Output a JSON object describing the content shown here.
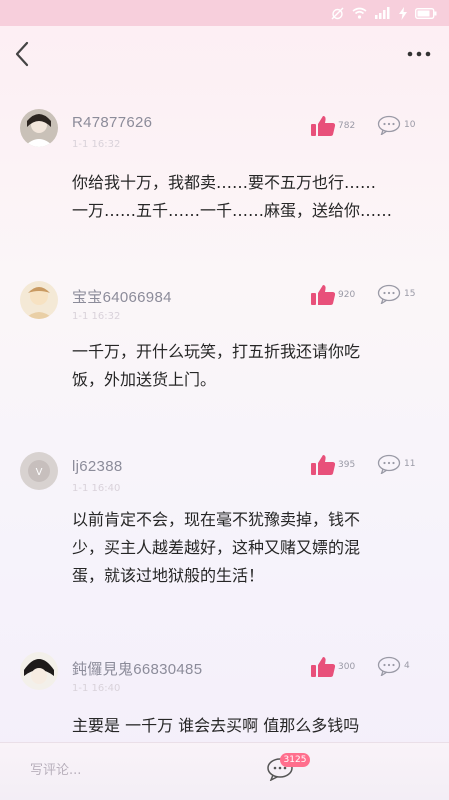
{
  "status_bar": {
    "icons": [
      "alarm-icon",
      "wifi-icon",
      "signal-icon",
      "charging-icon",
      "battery-icon"
    ],
    "battery": "▭"
  },
  "nav": {
    "back_icon": "chevron-left-icon",
    "more_icon": "more-icon",
    "more_label": "···"
  },
  "colors": {
    "accent": "#ff6f8d",
    "status_bar": "#f7cfdc",
    "username": "#8c8c9a"
  },
  "comments": [
    {
      "username": "R47877626",
      "timestamp": "1-1 16:32",
      "likes": "782",
      "replies": "10",
      "text_lines": [
        "你给我十万，我都卖……要不五万也行……",
        "一万……五千……一千……麻蛋，送给你……"
      ]
    },
    {
      "username": "宝宝64066984",
      "timestamp": "1-1 16:32",
      "likes": "920",
      "replies": "15",
      "text_lines": [
        "一千万，开什么玩笑，打五折我还请你吃",
        "饭，外加送货上门。"
      ]
    },
    {
      "username": "lj62388",
      "timestamp": "1-1 16:40",
      "likes": "395",
      "replies": "11",
      "text_lines": [
        "以前肯定不会，现在毫不犹豫卖掉，钱不",
        "少，买主人越差越好，这种又赌又嫖的混",
        "蛋，就该过地狱般的生活！"
      ]
    },
    {
      "username": "鈍儸見鬼66830485",
      "timestamp": "1-1 16:40",
      "likes": "300",
      "replies": "4",
      "text_lines": [
        "主要是 一千万 谁会去买啊 值那么多钱吗"
      ]
    }
  ],
  "bottom_bar": {
    "placeholder": "写评论...",
    "comment_count": "3125"
  }
}
